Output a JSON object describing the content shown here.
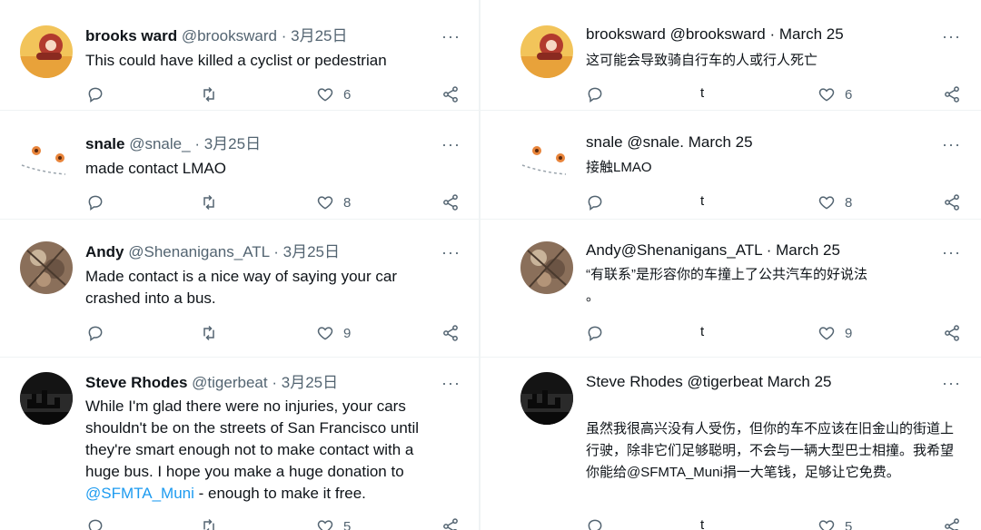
{
  "left": {
    "tweets": [
      {
        "name": "brooks ward",
        "handle": "@brooksward",
        "dot": "·",
        "date": "3月25日",
        "more": "···",
        "text": [
          "This could have killed a cyclist or pedestrian"
        ],
        "likes": "6",
        "retweet_icon": "retweet-icon"
      },
      {
        "name": "snale",
        "handle": "@snale_",
        "dot": "·",
        "date": "3月25日",
        "more": "···",
        "text": [
          "made contact LMAO"
        ],
        "likes": "8",
        "retweet_icon": "retweet-icon"
      },
      {
        "name": "Andy",
        "handle": "@Shenanigans_ATL",
        "dot": "·",
        "date": "3月25日",
        "more": "···",
        "text": [
          "Made contact is a nice way of saying your car",
          "crashed into a bus."
        ],
        "likes": "9",
        "retweet_icon": "retweet-icon"
      },
      {
        "name": "Steve Rhodes",
        "handle": "@tigerbeat",
        "dot": "·",
        "date": "3月25日",
        "more": "···",
        "text": [
          "While I'm glad there were no injuries, your cars",
          "shouldn't be on the streets of San Francisco until",
          "they're smart enough not to make contact with a",
          "huge bus. I hope you make a huge donation to"
        ],
        "link": "@SFMTA_Muni",
        "link_tail": " - enough to make it free.",
        "likes": "5",
        "retweet_icon": "retweet-icon"
      }
    ]
  },
  "right": {
    "tweets": [
      {
        "header": "brooksward @brooksward · March 25",
        "more": "···",
        "text": [
          "这可能会导致骑自行车的人或行人死亡"
        ],
        "rt_label": "t",
        "likes": "6"
      },
      {
        "header": "snale @snale. March 25",
        "more": "···",
        "text": [
          "接触LMAO"
        ],
        "rt_label": "t",
        "likes": "8"
      },
      {
        "header": "Andy@Shenanigans_ATL · March 25",
        "more": "···",
        "text": [
          "“有联系”是形容你的车撞上了公共汽车的好说法",
          "。"
        ],
        "rt_label": "t",
        "likes": "9"
      },
      {
        "header": "Steve Rhodes @tigerbeat March 25",
        "more": "···",
        "text": [
          "虽然我很高兴没有人受伤，但你的车不应该在旧金山的街道上",
          "行驶，除非它们足够聪明，不会与一辆大型巴士相撞。我希望",
          "你能给@SFMTA_Muni捐一大笔钱，足够让它免费。"
        ],
        "rt_label": "t",
        "likes": "5"
      }
    ]
  },
  "colors": {
    "text": "#0f1419",
    "muted": "#536471",
    "link": "#1d9bf0",
    "divider": "#eff3f4"
  }
}
